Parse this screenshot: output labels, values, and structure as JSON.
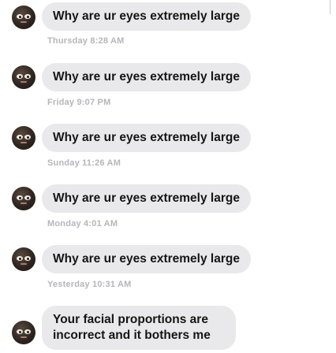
{
  "messages": [
    {
      "text": "Why are ur eyes extremely large",
      "timestamp": "Thursday 8:28 AM"
    },
    {
      "text": "Why are ur eyes extremely large",
      "timestamp": "Friday 9:07 PM"
    },
    {
      "text": "Why are ur eyes extremely large",
      "timestamp": "Sunday 11:26 AM"
    },
    {
      "text": "Why are ur eyes extremely large",
      "timestamp": "Monday 4:01 AM"
    },
    {
      "text": "Why are ur eyes extremely large",
      "timestamp": "Yesterday 10:31 AM"
    },
    {
      "text": "Your facial proportions are incorrect and it bothers me"
    }
  ],
  "colors": {
    "bubble": "#e9e9eb",
    "timestamp": "#b6b6bb",
    "text": "#151515"
  }
}
